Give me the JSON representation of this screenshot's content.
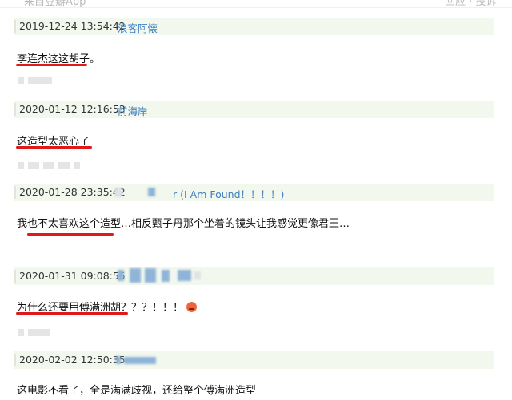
{
  "header": {
    "left_text": "来自豆瓣App",
    "right_text": "回应 · 投诉"
  },
  "comments": [
    {
      "timestamp": "2019-12-24 13:54:42",
      "user": "浪客阿懐",
      "text": "李连杰这这胡子。"
    },
    {
      "timestamp": "2020-01-12 12:16:53",
      "user": "前海岸",
      "text": "这造型太恶心了"
    },
    {
      "timestamp": "2020-01-28 23:35:42",
      "user": "r (I Am Found！！！！)",
      "text": "我也不太喜欢这个造型…相反甄子丹那个坐着的镜头让我感觉更像君王…"
    },
    {
      "timestamp": "2020-01-31 09:08:55",
      "user": "",
      "text": "为什么还要用傅满洲胡？？？！！！",
      "emoji": "angry-face-icon"
    },
    {
      "timestamp": "2020-02-02 12:50:35",
      "user": "",
      "text": "这电影不看了，全是满满歧视，还给整个傅满洲造型"
    }
  ],
  "colors": {
    "meta_bg": "#f2f8ee",
    "username": "#3f7fbf",
    "underline": "#e0191b"
  }
}
